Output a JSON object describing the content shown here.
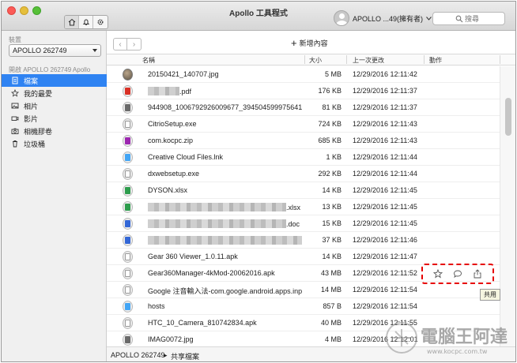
{
  "window": {
    "title": "Apollo 工具程式"
  },
  "user": {
    "label": "APOLLO ...49(擁有者)"
  },
  "search": {
    "placeholder": "搜尋"
  },
  "sidebar": {
    "device_section": "裝置",
    "device_selected": "APOLLO 262749",
    "open_section": "開啟 APOLLO 262749 Apollo",
    "items": [
      {
        "label": "檔案",
        "icon": "document-icon",
        "selected": true
      },
      {
        "label": "我的最愛",
        "icon": "star-icon"
      },
      {
        "label": "相片",
        "icon": "photo-icon"
      },
      {
        "label": "影片",
        "icon": "video-icon"
      },
      {
        "label": "相機膠卷",
        "icon": "camera-icon"
      },
      {
        "label": "垃圾桶",
        "icon": "trash-icon"
      }
    ]
  },
  "toolbar": {
    "new_label": "新增內容"
  },
  "columns": {
    "name": "名稱",
    "size": "大小",
    "modified": "上一次更改",
    "actions": "動作"
  },
  "files": [
    {
      "name": "20150421_140707.jpg",
      "size": "5 MB",
      "date": "12/29/2016 12:11:42",
      "icon": "photo-thumb",
      "blur": false
    },
    {
      "name": ".pdf",
      "size": "176 KB",
      "date": "12/29/2016 12:11:37",
      "icon": "pdf",
      "blur": true
    },
    {
      "name": "944908_1006792926009677_3945045999756412...",
      "size": "81 KB",
      "date": "12/29/2016 12:11:37",
      "icon": "image",
      "blur": false
    },
    {
      "name": "CitrioSetup.exe",
      "size": "724 KB",
      "date": "12/29/2016 12:11:43",
      "icon": "generic",
      "blur": false
    },
    {
      "name": "com.kocpc.zip",
      "size": "685 KB",
      "date": "12/29/2016 12:11:43",
      "icon": "zip",
      "blur": false
    },
    {
      "name": "Creative Cloud Files.lnk",
      "size": "1 KB",
      "date": "12/29/2016 12:11:44",
      "icon": "link",
      "blur": false
    },
    {
      "name": "dxwebsetup.exe",
      "size": "292 KB",
      "date": "12/29/2016 12:11:44",
      "icon": "generic",
      "blur": false
    },
    {
      "name": "DYSON.xlsx",
      "size": "14 KB",
      "date": "12/29/2016 12:11:45",
      "icon": "xls",
      "blur": false
    },
    {
      "name": ".xlsx",
      "size": "13 KB",
      "date": "12/29/2016 12:11:45",
      "icon": "xls",
      "blur": true
    },
    {
      "name": ".doc",
      "size": "15 KB",
      "date": "12/29/2016 12:11:45",
      "icon": "doc",
      "blur": true
    },
    {
      "name": "",
      "size": "37 KB",
      "date": "12/29/2016 12:11:46",
      "icon": "doc",
      "blur": true
    },
    {
      "name": "Gear 360 Viewer_1.0.11.apk",
      "size": "14 KB",
      "date": "12/29/2016 12:11:47",
      "icon": "generic",
      "blur": false
    },
    {
      "name": "Gear360Manager-4kMod-20062016.apk",
      "size": "43 MB",
      "date": "12/29/2016 12:11:52",
      "icon": "generic",
      "blur": false
    },
    {
      "name": "Google 注音輸入法-com.google.android.apps.inp...",
      "size": "14 MB",
      "date": "12/29/2016 12:11:54",
      "icon": "generic",
      "blur": false
    },
    {
      "name": "hosts",
      "size": "857 B",
      "date": "12/29/2016 12:11:54",
      "icon": "text",
      "blur": false
    },
    {
      "name": "HTC_10_Camera_810742834.apk",
      "size": "40 MB",
      "date": "12/29/2016 12:11:55",
      "icon": "generic",
      "blur": false
    },
    {
      "name": "IMAG0072.jpg",
      "size": "4 MB",
      "date": "12/29/2016 12:12:01",
      "icon": "image",
      "blur": false
    }
  ],
  "row_actions": {
    "tooltip": "共用"
  },
  "statusbar": {
    "device": "APOLLO 262749",
    "path": "共享檔案"
  },
  "watermark": {
    "text": "電腦王阿達",
    "url": "www.kocpc.com.tw"
  },
  "colors": {
    "accent": "#2f83f2",
    "highlight_box": "#e60000"
  }
}
